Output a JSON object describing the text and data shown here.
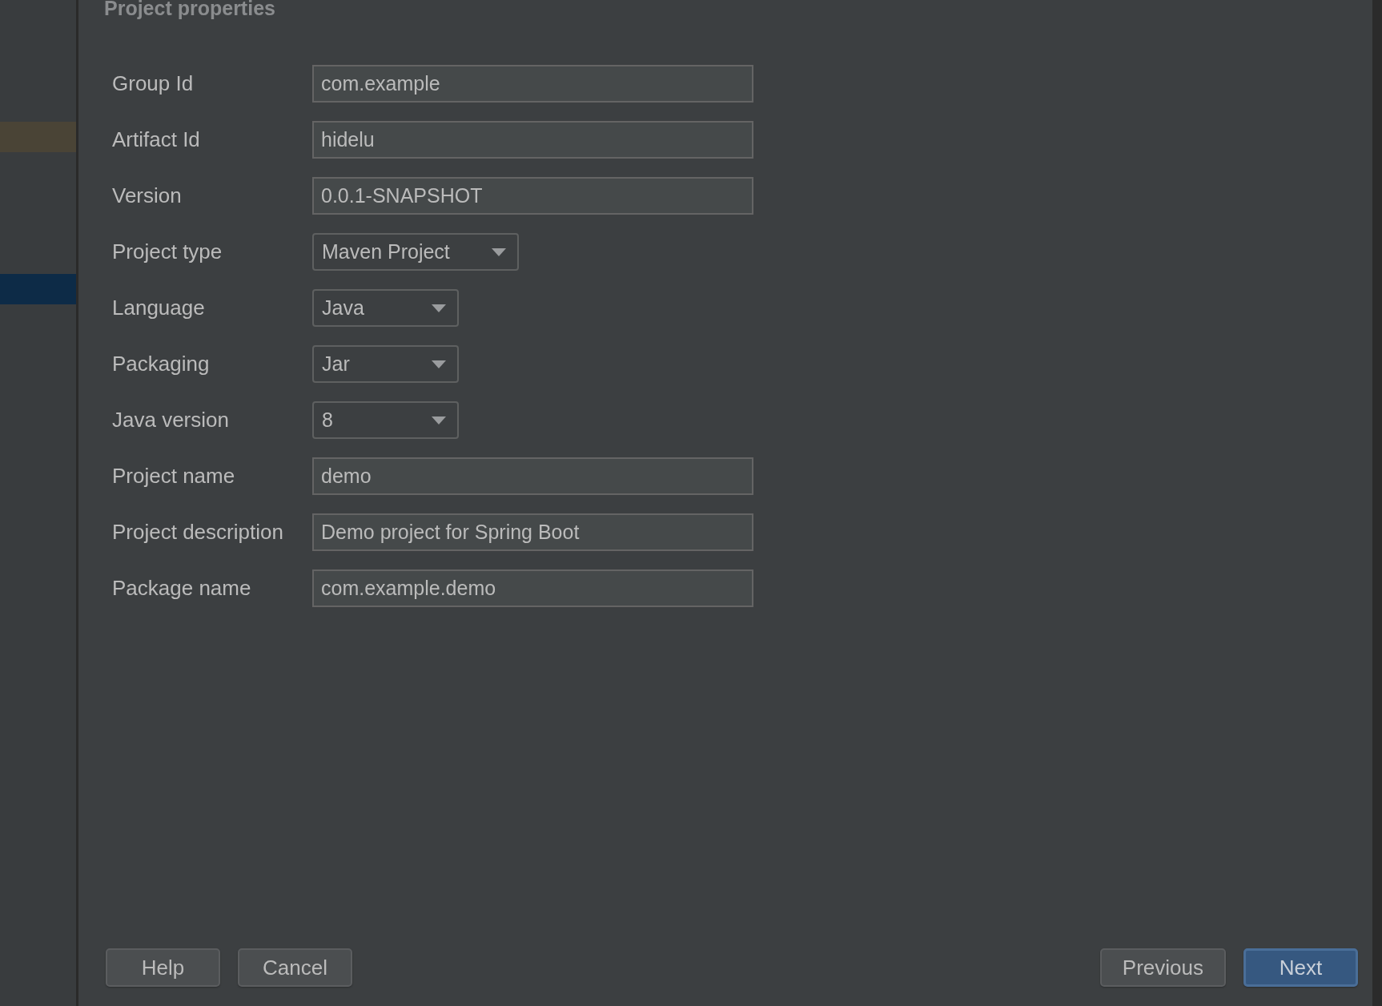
{
  "dialog": {
    "title": "Project properties"
  },
  "sidebar": {
    "items": [
      {
        "selected": false,
        "highlighted": true
      },
      {
        "selected": true,
        "highlighted": false
      }
    ]
  },
  "fields": [
    {
      "label": "Group Id",
      "kind": "text",
      "value": "com.example"
    },
    {
      "label": "Artifact Id",
      "kind": "text",
      "value": "hidelu"
    },
    {
      "label": "Version",
      "kind": "text",
      "value": "0.0.1-SNAPSHOT"
    },
    {
      "label": "Project type",
      "kind": "dropdown",
      "value": "Maven Project"
    },
    {
      "label": "Language",
      "kind": "dropdown",
      "value": "Java"
    },
    {
      "label": "Packaging",
      "kind": "dropdown",
      "value": "Jar"
    },
    {
      "label": "Java version",
      "kind": "dropdown",
      "value": "8"
    },
    {
      "label": "Project name",
      "kind": "text",
      "value": "demo"
    },
    {
      "label": "Project description",
      "kind": "text",
      "value": "Demo project for Spring Boot"
    },
    {
      "label": "Package name",
      "kind": "text",
      "value": "com.example.demo"
    }
  ],
  "buttons_left": [
    {
      "label": "Help",
      "default": false
    },
    {
      "label": "Cancel",
      "default": false
    }
  ],
  "buttons_right": [
    {
      "label": "Previous",
      "default": false
    },
    {
      "label": "Next",
      "default": true
    }
  ]
}
